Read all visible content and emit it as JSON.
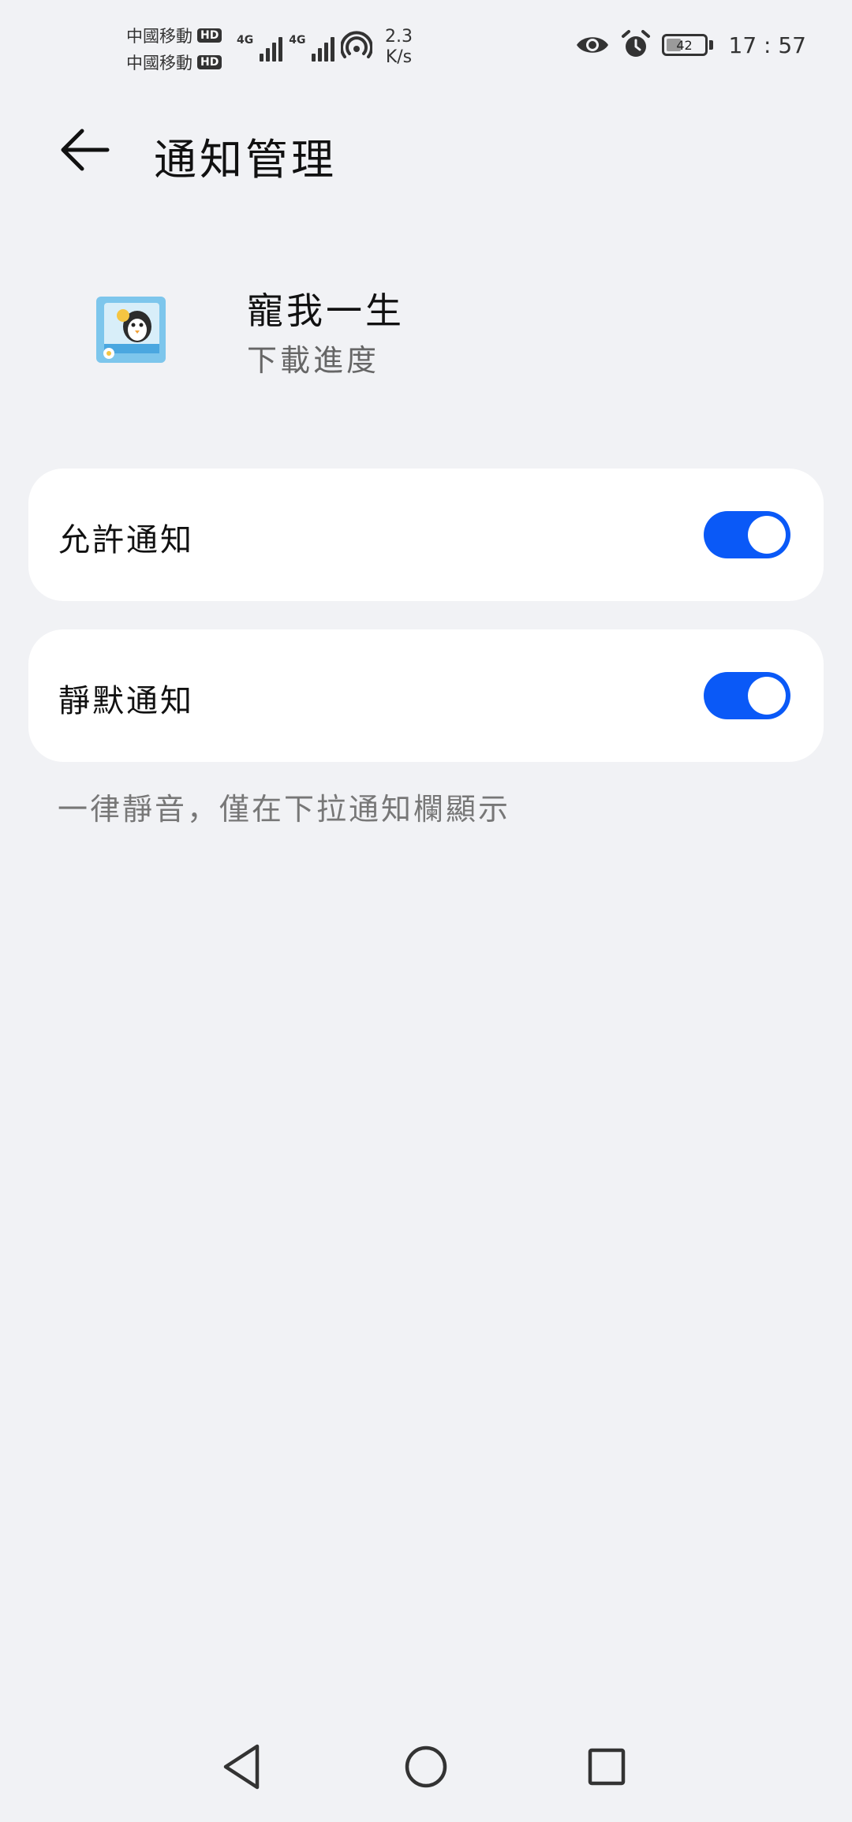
{
  "status_bar": {
    "carrier_1": "中國移動",
    "carrier_2": "中國移動",
    "hd_badge": "HD",
    "network_1": "4G",
    "network_2": "4G",
    "speed_value": "2.3",
    "speed_unit": "K/s",
    "battery_level": "42",
    "time": "17 : 57"
  },
  "header": {
    "title": "通知管理"
  },
  "app": {
    "name": "寵我一生",
    "subtitle": "下載進度"
  },
  "settings": [
    {
      "label": "允許通知",
      "enabled": true
    },
    {
      "label": "靜默通知",
      "enabled": true
    }
  ],
  "hint": "一律靜音，僅在下拉通知欄顯示",
  "colors": {
    "accent": "#0a59f7",
    "background": "#f1f2f5",
    "card": "#ffffff"
  },
  "icons": {
    "back": "arrow-left-icon",
    "eye": "eye-icon",
    "alarm": "alarm-icon",
    "nav_back": "triangle-back-icon",
    "nav_home": "circle-home-icon",
    "nav_recent": "square-recent-icon"
  }
}
